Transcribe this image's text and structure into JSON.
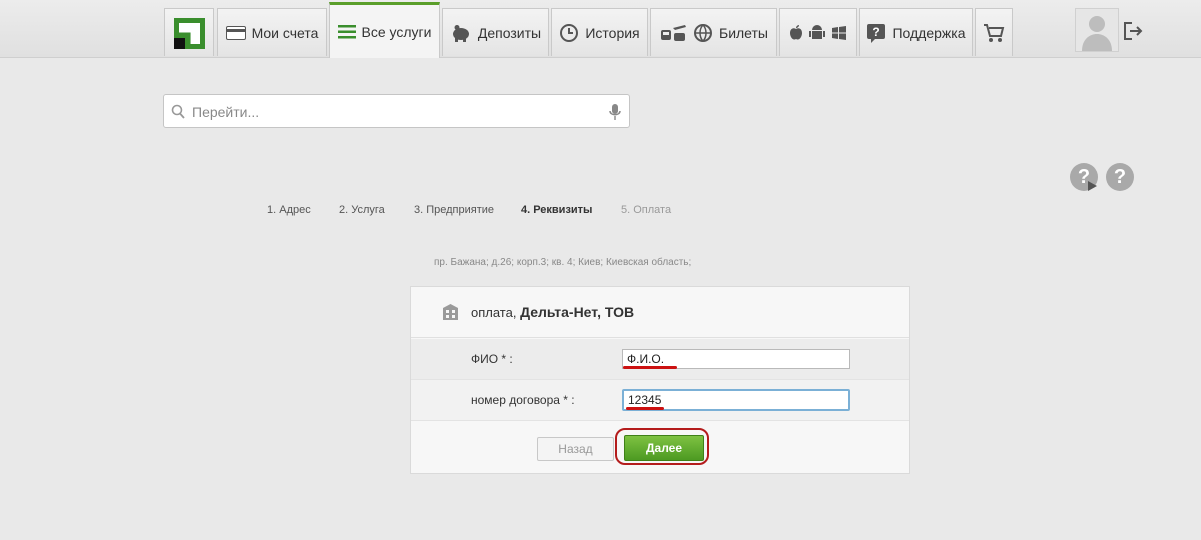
{
  "nav": {
    "items": [
      {
        "label": "Мои счета"
      },
      {
        "label": "Все услуги"
      },
      {
        "label": "Депозиты"
      },
      {
        "label": "История"
      },
      {
        "label": "Билеты"
      },
      {
        "label": ""
      },
      {
        "label": "Поддержка"
      },
      {
        "label": ""
      }
    ],
    "active": "Все услуги",
    "accent_color": "#5a9e2a"
  },
  "search": {
    "placeholder": "Перейти..."
  },
  "help": {
    "icon_1": "?",
    "icon_2": "?"
  },
  "steps": [
    {
      "label": "1.  Адрес"
    },
    {
      "label": "2.  Услуга"
    },
    {
      "label": "3.  Предприятие"
    },
    {
      "label": "4.  Реквизиты"
    },
    {
      "label": "5.  Оплата"
    }
  ],
  "address": "пр. Бажана; д.26; корп.3; кв. 4; Киев; Киевская область;",
  "payment": {
    "title_prefix": "оплата, ",
    "title_company": "Дельта-Нет, ТОВ",
    "fields": [
      {
        "label": "ФИО * :",
        "value": "Ф.И.О."
      },
      {
        "label": "номер договора * :",
        "value": "12345"
      }
    ],
    "back_label": "Назад",
    "next_label": "Далее"
  }
}
